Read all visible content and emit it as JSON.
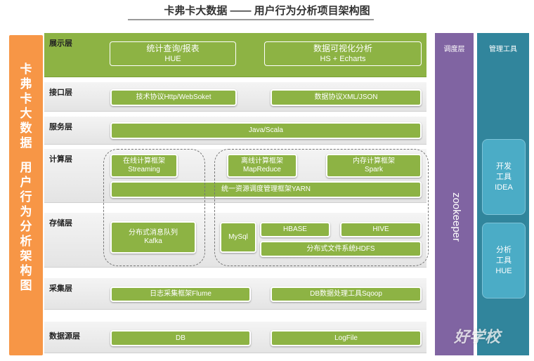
{
  "title": "卡弗卡大数据 —— 用户行为分析项目架构图",
  "left_panel": [
    "卡",
    "弗",
    "卡",
    "大",
    "数",
    "据",
    "",
    "用",
    "户",
    "行",
    "为",
    "分",
    "析",
    "架",
    "构",
    "图"
  ],
  "layers": {
    "display": {
      "label": "展示层",
      "box1": {
        "line1": "统计查询/报表",
        "line2": "HUE"
      },
      "box2": {
        "line1": "数据可视化分析",
        "line2": "HS + Echarts"
      }
    },
    "interface": {
      "label": "接口层",
      "box1": "技术协议Http/WebSoket",
      "box2": "数据协议XML/JSON"
    },
    "service": {
      "label": "服务层",
      "box1": "Java/Scala"
    },
    "compute": {
      "label": "计算层",
      "streaming": {
        "line1": "在线计算框架",
        "line2": "Streaming"
      },
      "mapreduce": {
        "line1": "离线计算框架",
        "line2": "MapReduce"
      },
      "spark": {
        "line1": "内存计算框架",
        "line2": "Spark"
      },
      "yarn": "统一资源调度管理框架YARN"
    },
    "storage": {
      "label": "存储层",
      "kafka": {
        "line1": "分布式消息队列",
        "line2": "Kafka"
      },
      "mysql": "MySql",
      "hbase": "HBASE",
      "hive": "HIVE",
      "hdfs": "分布式文件系统HDFS"
    },
    "collect": {
      "label": "采集层",
      "box1": "日志采集框架Flume",
      "box2": "DB数据处理工具Sqoop"
    },
    "source": {
      "label": "数据源层",
      "box1": "DB",
      "box2": "LogFile"
    }
  },
  "scheduler": {
    "head": "调度层",
    "name": "zookeeper"
  },
  "tools": {
    "head": "管理工具",
    "dev": {
      "line1": "开发",
      "line2": "工具",
      "line3": "IDEA"
    },
    "analysis": {
      "line1": "分析",
      "line2": "工具",
      "line3": "HUE"
    }
  },
  "watermark": "好学校"
}
